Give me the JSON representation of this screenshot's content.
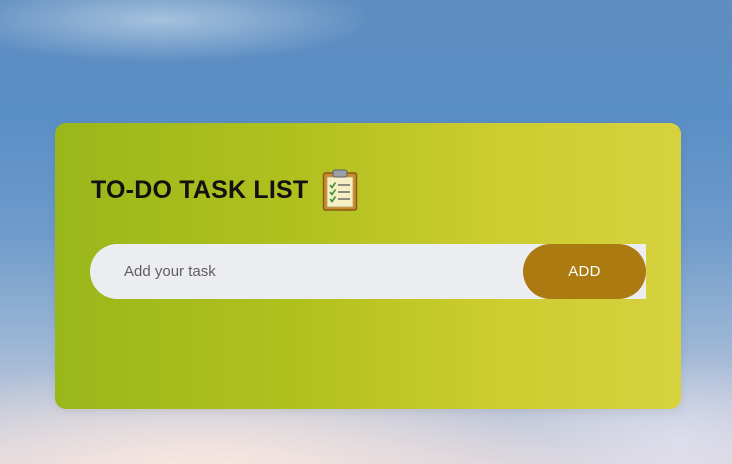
{
  "app": {
    "title": "TO-DO TASK LIST",
    "title_icon": "clipboard-checklist-icon"
  },
  "task_form": {
    "input_value": "",
    "input_placeholder": "Add your task",
    "add_button_label": "ADD"
  },
  "colors": {
    "card_gradient_start": "#9ab71a",
    "card_gradient_end": "#d6d23f",
    "input_background": "#ecedf0",
    "add_button_background": "#ab7a11",
    "title_text": "#111111",
    "sky_blue": "#5a8fc6"
  }
}
